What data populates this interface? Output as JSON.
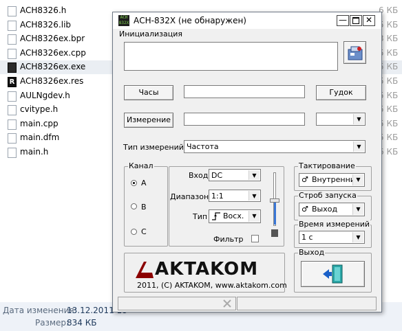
{
  "explorer": {
    "files": [
      {
        "name": "ACH8326.h",
        "size": "6 КБ",
        "type": "h"
      },
      {
        "name": "ACH8326.lib",
        "size": "5 КБ",
        "type": "lib"
      },
      {
        "name": "ACH8326ex.bpr",
        "size": "3 КБ",
        "type": "bpr"
      },
      {
        "name": "ACH8326ex.cpp",
        "size": "5 КБ",
        "type": "cpp"
      },
      {
        "name": "ACH8326ex.exe",
        "size": "5 КБ",
        "type": "exe"
      },
      {
        "name": "ACH8326ex.res",
        "size": "5 КБ",
        "type": "res"
      },
      {
        "name": "AULNgdev.h",
        "size": "5 КБ",
        "type": "h"
      },
      {
        "name": "cvitype.h",
        "size": "5 КБ",
        "type": "h"
      },
      {
        "name": "main.cpp",
        "size": "5 КБ",
        "type": "cpp"
      },
      {
        "name": "main.dfm",
        "size": "5 КБ",
        "type": "dfm"
      },
      {
        "name": "main.h",
        "size": "6 КБ",
        "type": "h"
      }
    ],
    "details": {
      "modified_label": "Дата изменения:",
      "modified_value": "13.12.2011 18",
      "size_label": "Размер:",
      "size_value": "834 КБ"
    }
  },
  "dialog": {
    "title": "АСН-832Х (не обнаружен)",
    "app_icon_text": "ACH 832X",
    "init_group": "Инициализация",
    "clock_button": "Часы",
    "beep_button": "Гудок",
    "measure_button": "Измерение",
    "meas_type_label": "Тип измерений:",
    "meas_type_value": "Частота",
    "channel": {
      "group": "Канал",
      "options": [
        "A",
        "B",
        "C"
      ],
      "selected": "A"
    },
    "input_label": "Вход",
    "input_value": "DC",
    "range_label": "Диапазон",
    "range_value": "1:1",
    "type_label": "Тип",
    "type_value": "Восх.",
    "filter_label": "Фильтр",
    "clocking_group": "Тактирование",
    "clocking_value": "Внутренний",
    "strobe_group": "Строб запуска",
    "strobe_value": "Выход",
    "meas_time_group": "Время измерений",
    "meas_time_value": "1 с",
    "exit_group": "Выход",
    "logo_text": "AKTAKOM",
    "logo_caption": "2011, (C) AKTAKOM, www.aktakom.com",
    "accent_color": "#8b0000"
  }
}
